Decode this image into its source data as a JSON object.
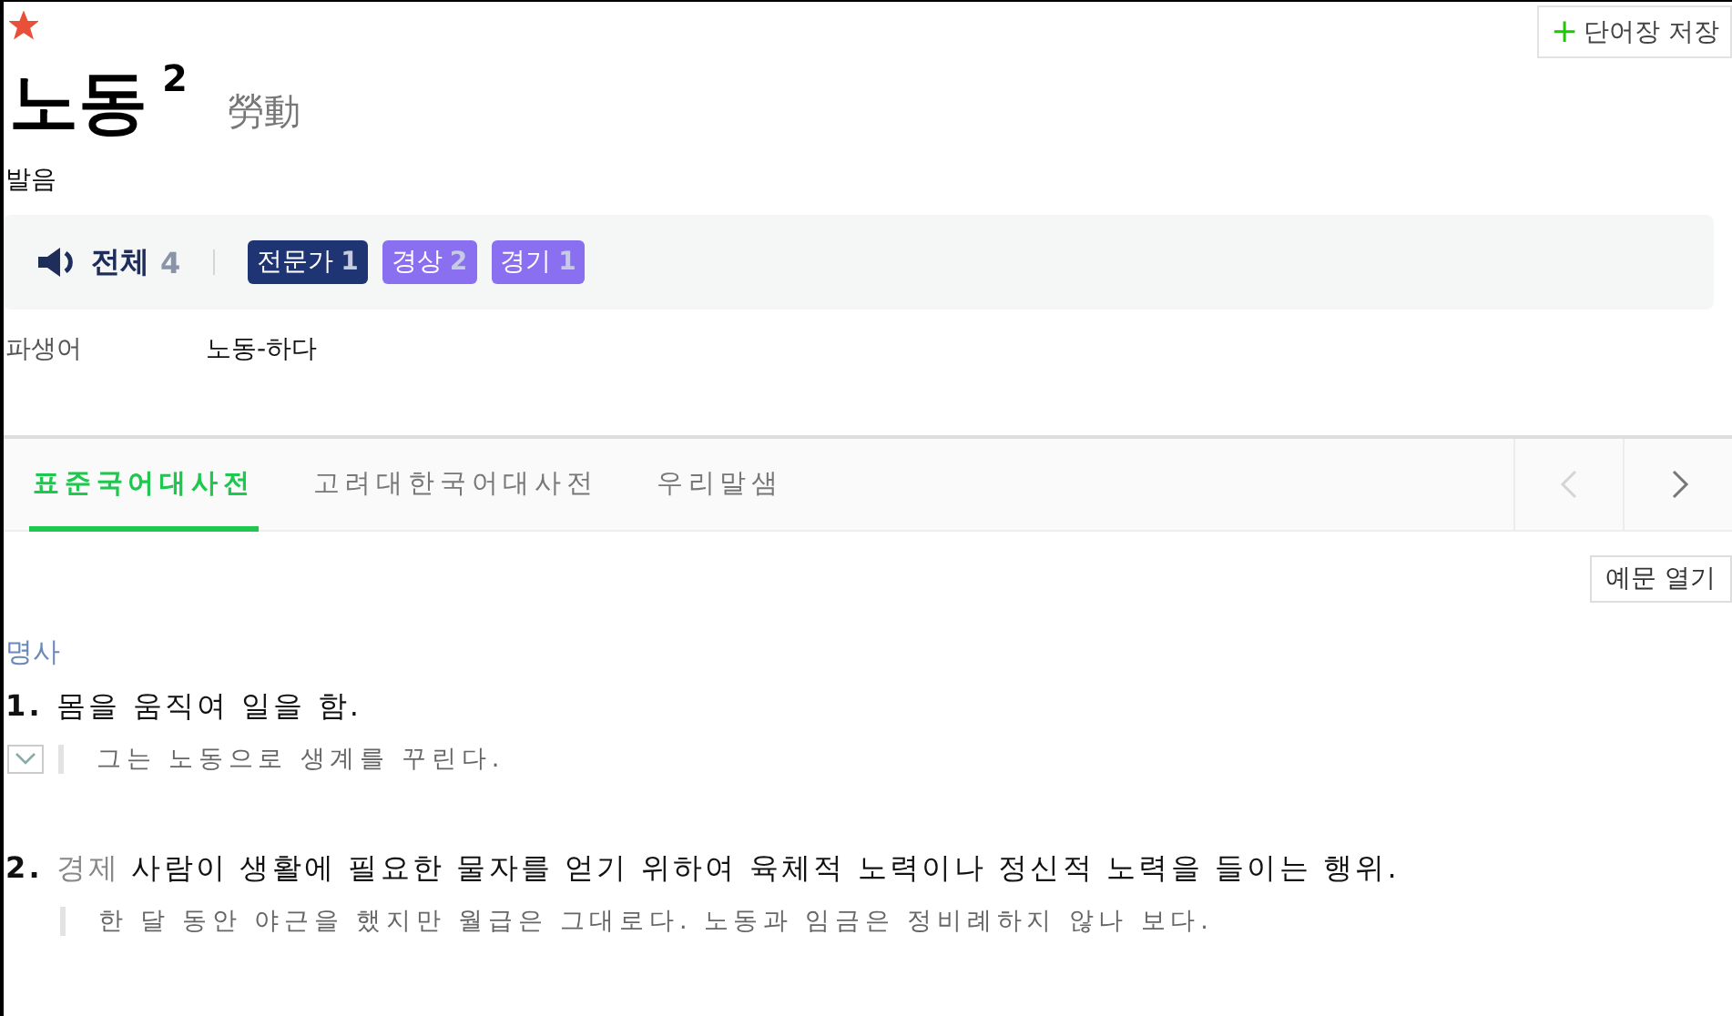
{
  "favorite": {
    "starred": true
  },
  "headword": "노동",
  "homograph": "2",
  "hanja": "勞動",
  "save_button": {
    "icon": "+",
    "label": "단어장 저장"
  },
  "pronunciation": {
    "label": "발음",
    "all": {
      "label": "전체",
      "count": "4"
    },
    "filters": [
      {
        "label": "전문가",
        "count": "1",
        "selected": true
      },
      {
        "label": "경상",
        "count": "2",
        "selected": false
      },
      {
        "label": "경기",
        "count": "1",
        "selected": false
      }
    ]
  },
  "derived": {
    "label": "파생어",
    "value": "노동-하다"
  },
  "tabs": [
    {
      "label": "표준국어대사전",
      "selected": true
    },
    {
      "label": "고려대한국어대사전",
      "selected": false
    },
    {
      "label": "우리말샘",
      "selected": false
    }
  ],
  "tab_nav": {
    "prev_disabled": true,
    "next_disabled": false
  },
  "examples_toggle": "예문 열기",
  "part_of_speech": "명사",
  "senses": [
    {
      "number": "1.",
      "definition": "몸을 움직여 일을 함.",
      "more_examples": true,
      "examples": [
        "그는 노동으로 생계를 꾸린다."
      ]
    },
    {
      "number": "2.",
      "domain": "경제",
      "definition": "사람이 생활에 필요한 물자를 얻기 위하여 육체적 노력이나 정신적 노력을 들이는 행위.",
      "more_examples": false,
      "examples": [
        "한 달 동안 야근을 했지만 월급은 그대로다. 노동과 임금은 정비례하지 않나 보다."
      ]
    }
  ]
}
